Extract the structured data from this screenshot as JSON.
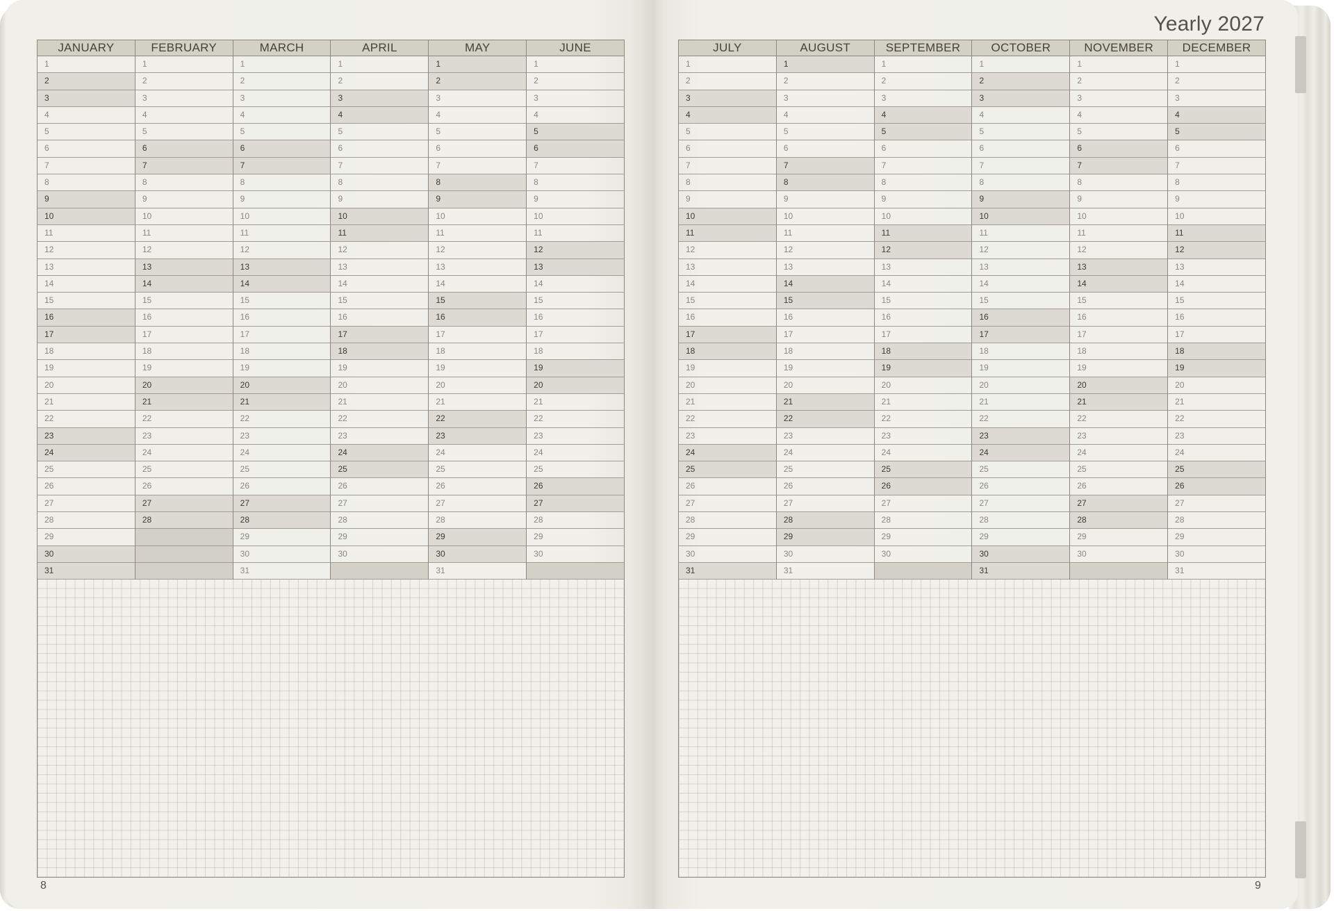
{
  "spread": {
    "title": "Yearly 2027",
    "left_page_number": "8",
    "right_page_number": "9"
  },
  "left_months": [
    {
      "name": "JANUARY",
      "days": 31,
      "highlight": [
        2,
        3,
        9,
        10,
        16,
        17,
        23,
        24,
        30,
        31
      ],
      "bold": [
        2,
        3,
        9,
        10,
        16,
        17,
        23,
        24,
        30,
        31
      ]
    },
    {
      "name": "FEBRUARY",
      "days": 28,
      "highlight": [
        6,
        7,
        13,
        14,
        20,
        21,
        27,
        28
      ],
      "bold": [
        6,
        7,
        13,
        14,
        20,
        21,
        27,
        28
      ]
    },
    {
      "name": "MARCH",
      "days": 31,
      "highlight": [
        6,
        7,
        13,
        14,
        20,
        21,
        27,
        28
      ],
      "bold": [
        6,
        7,
        13,
        14,
        20,
        21,
        27,
        28
      ]
    },
    {
      "name": "APRIL",
      "days": 30,
      "highlight": [
        3,
        4,
        10,
        11,
        17,
        18,
        24,
        25
      ],
      "bold": [
        3,
        4,
        10,
        11,
        17,
        18,
        24,
        25
      ]
    },
    {
      "name": "MAY",
      "days": 31,
      "highlight": [
        1,
        2,
        8,
        9,
        15,
        16,
        22,
        23,
        29,
        30
      ],
      "bold": [
        1,
        2,
        8,
        9,
        15,
        16,
        22,
        23,
        29,
        30
      ]
    },
    {
      "name": "JUNE",
      "days": 30,
      "highlight": [
        5,
        6,
        12,
        13,
        19,
        20,
        26,
        27
      ],
      "bold": [
        5,
        6,
        12,
        13,
        19,
        20,
        26,
        27
      ]
    }
  ],
  "right_months": [
    {
      "name": "JULY",
      "days": 31,
      "highlight": [
        3,
        4,
        10,
        11,
        17,
        18,
        24,
        25,
        31
      ],
      "bold": [
        3,
        4,
        10,
        11,
        17,
        18,
        24,
        25,
        31
      ]
    },
    {
      "name": "AUGUST",
      "days": 31,
      "highlight": [
        1,
        7,
        8,
        14,
        15,
        21,
        22,
        28,
        29
      ],
      "bold": [
        1,
        7,
        8,
        14,
        15,
        21,
        22,
        28,
        29
      ]
    },
    {
      "name": "SEPTEMBER",
      "days": 30,
      "highlight": [
        4,
        5,
        11,
        12,
        18,
        19,
        25,
        26
      ],
      "bold": [
        4,
        5,
        11,
        12,
        18,
        19,
        25,
        26
      ]
    },
    {
      "name": "OCTOBER",
      "days": 31,
      "highlight": [
        2,
        3,
        9,
        10,
        16,
        17,
        23,
        24,
        30,
        31
      ],
      "bold": [
        2,
        3,
        9,
        10,
        16,
        17,
        23,
        24,
        30,
        31
      ]
    },
    {
      "name": "NOVEMBER",
      "days": 30,
      "highlight": [
        6,
        7,
        13,
        14,
        20,
        21,
        27,
        28
      ],
      "bold": [
        6,
        7,
        13,
        14,
        20,
        21,
        27,
        28
      ]
    },
    {
      "name": "DECEMBER",
      "days": 31,
      "highlight": [
        4,
        5,
        11,
        12,
        18,
        19,
        25,
        26
      ],
      "bold": [
        4,
        5,
        11,
        12,
        18,
        19,
        25,
        26
      ]
    }
  ],
  "colors": {
    "paper": "#f0efe9",
    "header": "#d3d0c6",
    "weekend": "#dcdad2",
    "line": "#8c887d"
  }
}
